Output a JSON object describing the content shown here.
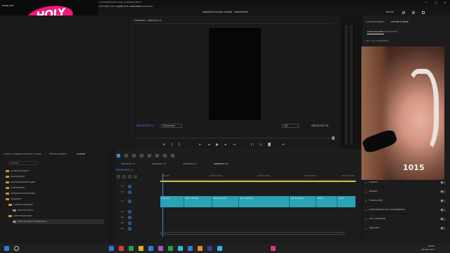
{
  "window": {
    "title": "Adobe Premiere Pro — C:\\Users\\user\\Documents\\Adobe\\Premiere Pro\\24.0\\Magenschulung Gütlow.prproj *",
    "controls": [
      "—",
      "□",
      "✕"
    ]
  },
  "menu": [
    "Datei",
    "Bearbeiten",
    "Clip",
    "Sequenz",
    "Markierungen",
    "Grafiken und Titel",
    "Ansicht",
    "Fenster",
    "Hilfe"
  ],
  "workspace": {
    "title": "Magenschulung Gütlow - Bearbeitet",
    "share_label": "TEILEN"
  },
  "logo": {
    "text": "HOLY",
    "overlay_label": "WEBCAM"
  },
  "program_monitor": {
    "tab": "Programm: Sequenz 04",
    "playhead_tc": "00:00:00:11",
    "fit_value": "Einpassen",
    "quality_value": "1/4",
    "duration_tc": "00:03:42:55"
  },
  "transport_icons": [
    "marker-icon",
    "in-point-icon",
    "out-point-icon",
    "go-to-in-icon",
    "step-back-icon",
    "play-icon",
    "step-forward-icon",
    "go-to-out-icon",
    "lift-icon",
    "extract-icon",
    "export-frame-icon",
    "settings-icon"
  ],
  "right_panel": {
    "tabs": [
      "Grafikvorlagen",
      "Lumetri-Farbe"
    ],
    "subtabs": [
      "Durchsuchen",
      "Bearbeiten"
    ],
    "clip_label": "Kein Clip ausgewählt",
    "webcam_number": "1015",
    "effects": [
      "Einfach",
      "Kreativ",
      "Farbkurven",
      "Farbradkreis und Farbabgleich",
      "HSL-Sekundär",
      "Vignette"
    ]
  },
  "project_panel": {
    "tabs": [
      "Projekt: Magenschulung Gütlow",
      "Media-Browser",
      "Effekte"
    ],
    "search_placeholder": "suchen",
    "bins": [
      {
        "label": "Lautstärkeregler"
      },
      {
        "label": "Audioeffekte"
      },
      {
        "label": "Audioüberblendungen"
      },
      {
        "label": "Videoeffekte"
      },
      {
        "label": "Videoüberblendungen"
      },
      {
        "label": "Vorgaben"
      },
      {
        "label": "Lumetri-Vorgaben"
      },
      {
        "label": "Weiche Kante"
      },
      {
        "label": "Überblendungen"
      },
      {
        "label": "Weiche Kante eingezoomt"
      }
    ]
  },
  "timeline": {
    "tabs": [
      "Sequenz 02",
      "Sequenz 03",
      "Sequenz 01",
      "Sequenz 04"
    ],
    "timecode": "00:00:00:11",
    "ruler_ticks": [
      "00:00",
      "00:00:15:00",
      "00:00:30:00",
      "00:00:45:00",
      "00:01:00:00"
    ],
    "tracks": [
      "V3",
      "V2",
      "V1",
      "A1",
      "A2",
      "A3",
      "A4"
    ],
    "clips": [
      "Clip Ans",
      "Clip 1 Studio",
      "Clip 2 Studio",
      "Clip 3 Studio",
      "Clip 4 Studio",
      "Clip 5",
      "Clip 6"
    ]
  },
  "taskbar": {
    "time": "16:45",
    "date": "08.04.2024",
    "icon_colors": [
      "#2f7bd8",
      "#e03a2f",
      "#1fa04b",
      "#e8b21a",
      "#2f7bd8",
      "#9b59d0",
      "#1fa04b",
      "#2fb6e8",
      "#2f7bd8",
      "#e8891a",
      "#3b3b9a",
      "#2fb6e8",
      "#d23a8a"
    ]
  },
  "colors": {
    "accent": "#3b8ae6",
    "clip": "#2aa3b5",
    "logo_pink": "#f0187a",
    "work_area": "#d6c34a"
  }
}
